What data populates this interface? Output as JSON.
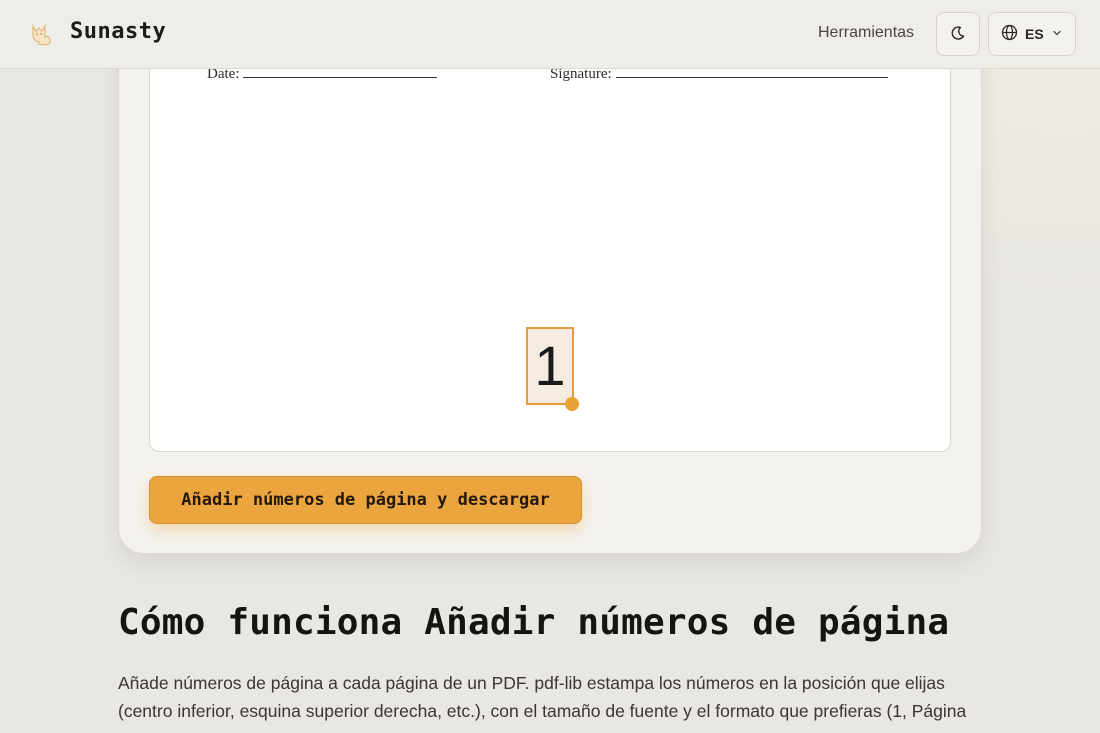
{
  "header": {
    "brand": "Sunasty",
    "nav_tools": "Herramientas",
    "language_code": "ES"
  },
  "preview": {
    "date_label": "Date:",
    "signature_label": "Signature:",
    "page_number": "1"
  },
  "cta_label": "Añadir números de página y descargar",
  "section": {
    "title": "Cómo funciona Añadir números de página",
    "body": "Añade números de página a cada página de un PDF. pdf-lib estampa los números en la posición que elijas (centro inferior, esquina superior derecha, etc.), con el tamaño de fuente y el formato que prefieras (1, Página"
  },
  "colors": {
    "accent": "#eba53f",
    "page_bg": "#e9e7e2",
    "card_bg": "#f4f2ee"
  },
  "icons": {
    "logo": "cat-logo-icon",
    "theme": "moon-icon",
    "language": "globe-icon",
    "dropdown": "chevron-down-icon"
  }
}
